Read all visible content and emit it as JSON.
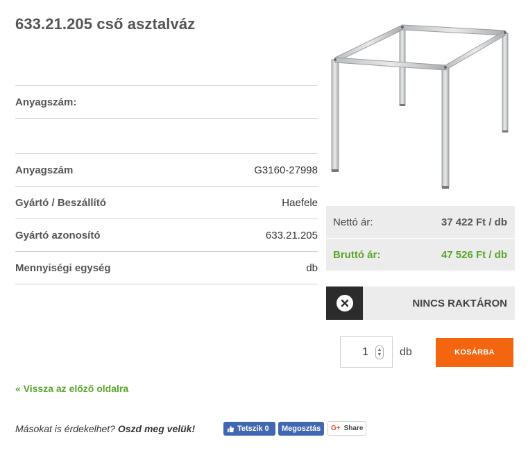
{
  "product": {
    "title": "633.21.205 cső asztalváz"
  },
  "details": {
    "header_label": "Anyagszám:",
    "rows": [
      {
        "label": "Anyagszám",
        "value": "G3160-27998"
      },
      {
        "label": "Gyártó / Beszállító",
        "value": "Haefele"
      },
      {
        "label": "Gyártó azonosító",
        "value": "633.21.205"
      },
      {
        "label": "Mennyiségi egység",
        "value": "db"
      }
    ]
  },
  "price": {
    "net_label": "Nettó ár:",
    "net_value": "37 422 Ft / db",
    "gross_label": "Bruttó ár:",
    "gross_value": "47 526 Ft / db"
  },
  "stock": {
    "status": "NINCS RAKTÁRON",
    "icon": "close-circle-icon"
  },
  "cart": {
    "quantity": "1",
    "unit": "db",
    "button": "KOSÁRBA"
  },
  "nav": {
    "back": "« Vissza az előző oldalra"
  },
  "share": {
    "prompt": "Másokat is érdekelhet?",
    "cta": "Oszd meg velük!",
    "fb_like": "Tetszik 0",
    "fb_share": "Megosztás",
    "gplus": "Share"
  },
  "colors": {
    "accent_orange": "#f4650f",
    "accent_green": "#5aa52a",
    "facebook_blue": "#4267b2"
  }
}
